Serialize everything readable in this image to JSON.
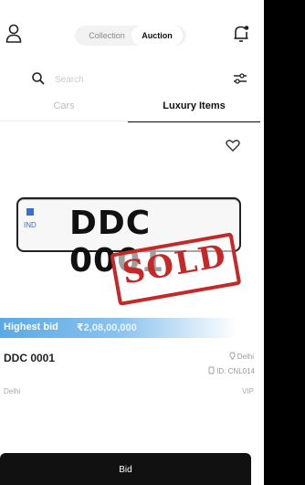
{
  "header": {
    "segment": [
      {
        "label": "Collection",
        "active": false
      },
      {
        "label": "Auction",
        "active": true
      }
    ],
    "icons": {
      "profile": "user-icon",
      "notifications": "bell-icon"
    }
  },
  "search": {
    "placeholder": "Search",
    "filter_icon": "sliders-icon"
  },
  "category_tabs": [
    {
      "label": "Cars",
      "active": false
    },
    {
      "label": "Luxury Items",
      "active": true
    }
  ],
  "listing": {
    "plate": {
      "country": "IND",
      "number": "DDC 0001"
    },
    "stamp": "SOLD",
    "highest_bid_label": "Highest bid",
    "highest_bid_value": "₹2,08,00,000",
    "title": "DDC 0001",
    "location": "Delhi",
    "id": "ID: CNL014",
    "city": "Delhi",
    "category": "VIP"
  },
  "actions": {
    "bid_label": "Bid"
  },
  "colors": {
    "accent": "#5aa9e6",
    "stamp": "#c62828",
    "button": "#111111"
  }
}
